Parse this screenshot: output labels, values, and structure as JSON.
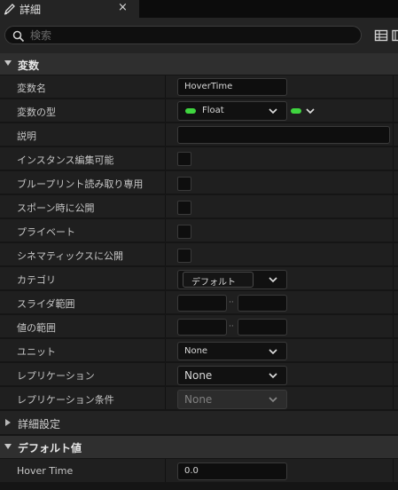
{
  "tab": {
    "title": "詳細",
    "close": "×"
  },
  "search": {
    "placeholder": "検索",
    "value": ""
  },
  "sections": {
    "variables": "変数",
    "advanced": "詳細設定",
    "default_value": "デフォルト値"
  },
  "rows": {
    "var_name": {
      "label": "変数名",
      "value": "HoverTime"
    },
    "var_type": {
      "label": "変数の型",
      "value": "Float",
      "color": "#3fd53f"
    },
    "description": {
      "label": "説明",
      "value": ""
    },
    "instance_editable": {
      "label": "インスタンス編集可能"
    },
    "blueprint_readonly": {
      "label": "ブループリント読み取り専用"
    },
    "expose_on_spawn": {
      "label": "スポーン時に公開"
    },
    "private": {
      "label": "プライベート"
    },
    "expose_cinematics": {
      "label": "シネマティックスに公開"
    },
    "category": {
      "label": "カテゴリ",
      "value": "デフォルト"
    },
    "slider_range": {
      "label": "スライダ範囲",
      "min": "",
      "max": ""
    },
    "value_range": {
      "label": "値の範囲",
      "min": "",
      "max": ""
    },
    "units": {
      "label": "ユニット",
      "value": "None"
    },
    "replication": {
      "label": "レプリケーション",
      "value": "None"
    },
    "replication_condition": {
      "label": "レプリケーション条件",
      "value": "None"
    },
    "hover_time": {
      "label": "Hover Time",
      "value": "0.0"
    }
  }
}
